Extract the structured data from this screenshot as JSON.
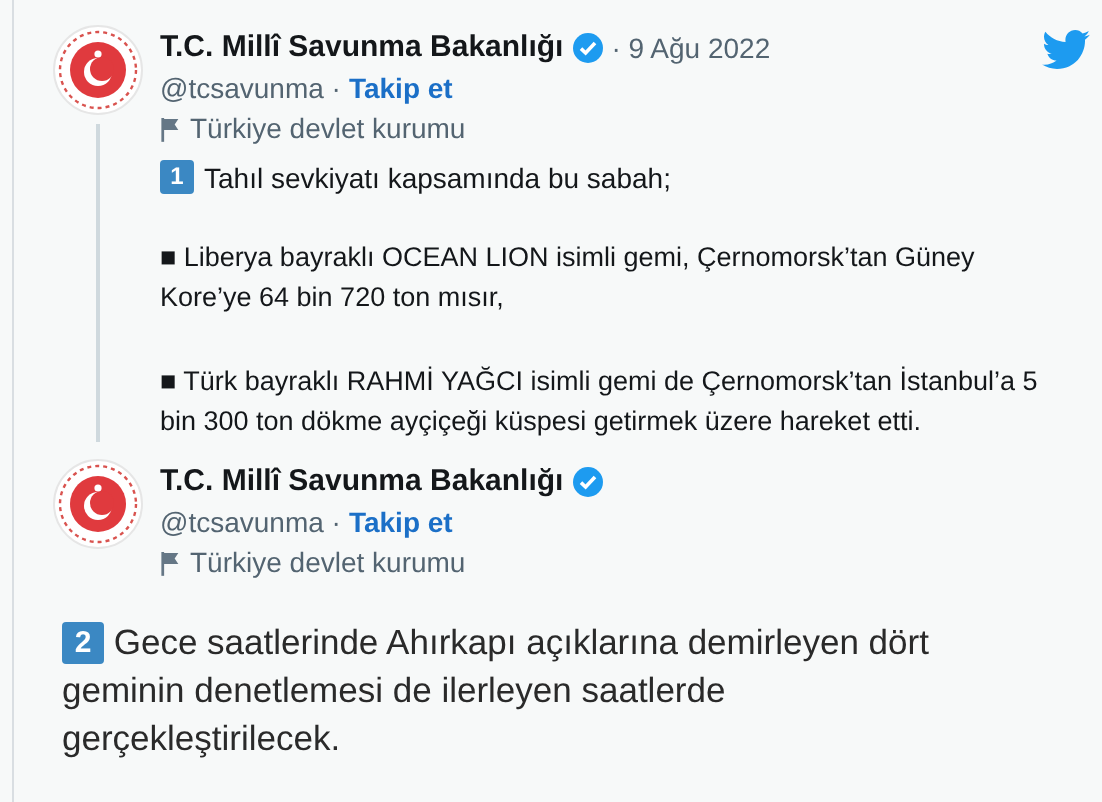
{
  "tweets": [
    {
      "name": "T.C. Millî Savunma Bakanlığı",
      "verified": true,
      "date": "· 9 Ağu 2022",
      "handle": "@tcsavunma ·",
      "follow": "Takip et",
      "label": "Türkiye devlet kurumu",
      "badge": "1",
      "lead": "Tahıl sevkiyatı kapsamında bu sabah;",
      "paragraphs": [
        "■ Liberya bayraklı OCEAN LION isimli gemi, Çernomorsk’tan Güney Kore’ye 64 bin 720 ton mısır,",
        "■ Türk bayraklı RAHMİ YAĞCI isimli gemi de Çernomorsk’tan İstanbul’a 5 bin 300 ton dökme ayçiçeği küspesi getirmek üzere hareket etti."
      ],
      "thread": true
    },
    {
      "name": "T.C. Millî Savunma Bakanlığı",
      "verified": true,
      "handle": "@tcsavunma ·",
      "follow": "Takip et",
      "label": "Türkiye devlet kurumu",
      "badge": "2",
      "lead": "Gece saatlerinde Ahırkapı açıklarına demirleyen dört geminin denetlemesi de ilerleyen saatlerde gerçekleştirilecek.",
      "thread": false
    }
  ]
}
